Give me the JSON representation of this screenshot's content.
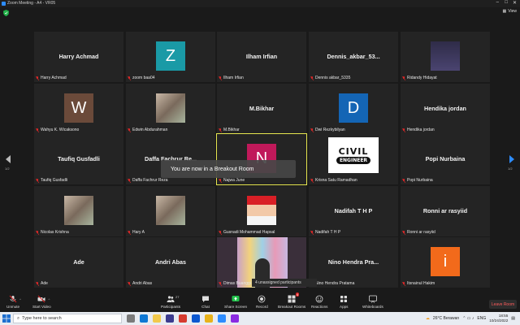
{
  "window": {
    "title": "Zoom Meeting - A4 - VR05"
  },
  "top_bar": {
    "view_label": "View"
  },
  "pagination": {
    "left": "1/2",
    "right": "1/2"
  },
  "toast": "You are now in a Breakout Room",
  "unassigned": "4 unassigned participants",
  "tiles": [
    {
      "name": "Harry Achmad",
      "label": "Harry Achmad",
      "kind": "text"
    },
    {
      "name": "",
      "label": "zoom baa04",
      "kind": "letter",
      "letter": "Z",
      "color": "#1a9aa6"
    },
    {
      "name": "Ilham Irfian",
      "label": "Ilham Irfian",
      "kind": "text"
    },
    {
      "name": "Dennis_akbar_53...",
      "label": "Dennis akbar_5335",
      "kind": "text"
    },
    {
      "name": "",
      "label": "Ridandy Hidayat",
      "kind": "photo-dark"
    },
    {
      "name": "",
      "label": "Wahyu K. Wicaksono",
      "kind": "letter",
      "letter": "W",
      "color": "#6b4a3a"
    },
    {
      "name": "",
      "label": "Edwin Abdurahman",
      "kind": "photo"
    },
    {
      "name": "M.Bikhar",
      "label": "M.Bikhar",
      "kind": "text"
    },
    {
      "name": "",
      "label": "Dwi Rezkybilyan",
      "kind": "letter",
      "letter": "D",
      "color": "#1465b5"
    },
    {
      "name": "Hendika jordan",
      "label": "Hendika jordan",
      "kind": "text"
    },
    {
      "name": "Taufiq Gusfadli",
      "label": "Taufiq Gusfadli",
      "kind": "text"
    },
    {
      "name": "Daffa Fachrur Re...",
      "label": "Daffa Fachrur Reza",
      "kind": "text"
    },
    {
      "name": "",
      "label": "Najwa June",
      "kind": "letter",
      "letter": "N",
      "color": "#c0195a",
      "active": true
    },
    {
      "name": "",
      "label": "Krisna Satu Ramadhan",
      "kind": "logo",
      "logo_top": "CIVIL",
      "logo_bottom": "ENGINEER"
    },
    {
      "name": "Popi Nurbaina",
      "label": "Popi Nurbaina",
      "kind": "text"
    },
    {
      "name": "",
      "label": "Nicolas Krishna",
      "kind": "photo"
    },
    {
      "name": "",
      "label": "Hary A",
      "kind": "photo"
    },
    {
      "name": "",
      "label": "Gusnadi Mohammad Hapsal",
      "kind": "photo-red"
    },
    {
      "name": "Nadifah T H P",
      "label": "Nadifah T H P",
      "kind": "text"
    },
    {
      "name": "Ronni ar rasyiid",
      "label": "Ronni ar rasyiid",
      "kind": "text"
    },
    {
      "name": "Ade",
      "label": "Ade",
      "kind": "text"
    },
    {
      "name": "Andri Abas",
      "label": "Andri Abas",
      "kind": "text"
    },
    {
      "name": "",
      "label": "Dimas Buanggi",
      "kind": "video"
    },
    {
      "name": "Nino Hendra Pra...",
      "label": "Nino Hendra Pratama",
      "kind": "text"
    },
    {
      "name": "",
      "label": "Itsnainul Hakim",
      "kind": "letter",
      "letter": "i",
      "color": "#f26a1b"
    }
  ],
  "toolbar": {
    "unmute": "Unmute",
    "start_video": "Start Video",
    "participants": "Participants",
    "participants_count": "27",
    "chat": "Chat",
    "share_screen": "Share Screen",
    "record": "Record",
    "breakout_rooms": "Breakout Rooms",
    "breakout_badge": "4",
    "reactions": "Reactions",
    "apps": "Apps",
    "whiteboards": "Whiteboards",
    "leave": "Leave Room"
  },
  "taskbar": {
    "search_placeholder": "Type here to search",
    "weather": "26°C  Berawan",
    "time": "18:55",
    "date": "10/24/2022",
    "lang": "ENG"
  }
}
